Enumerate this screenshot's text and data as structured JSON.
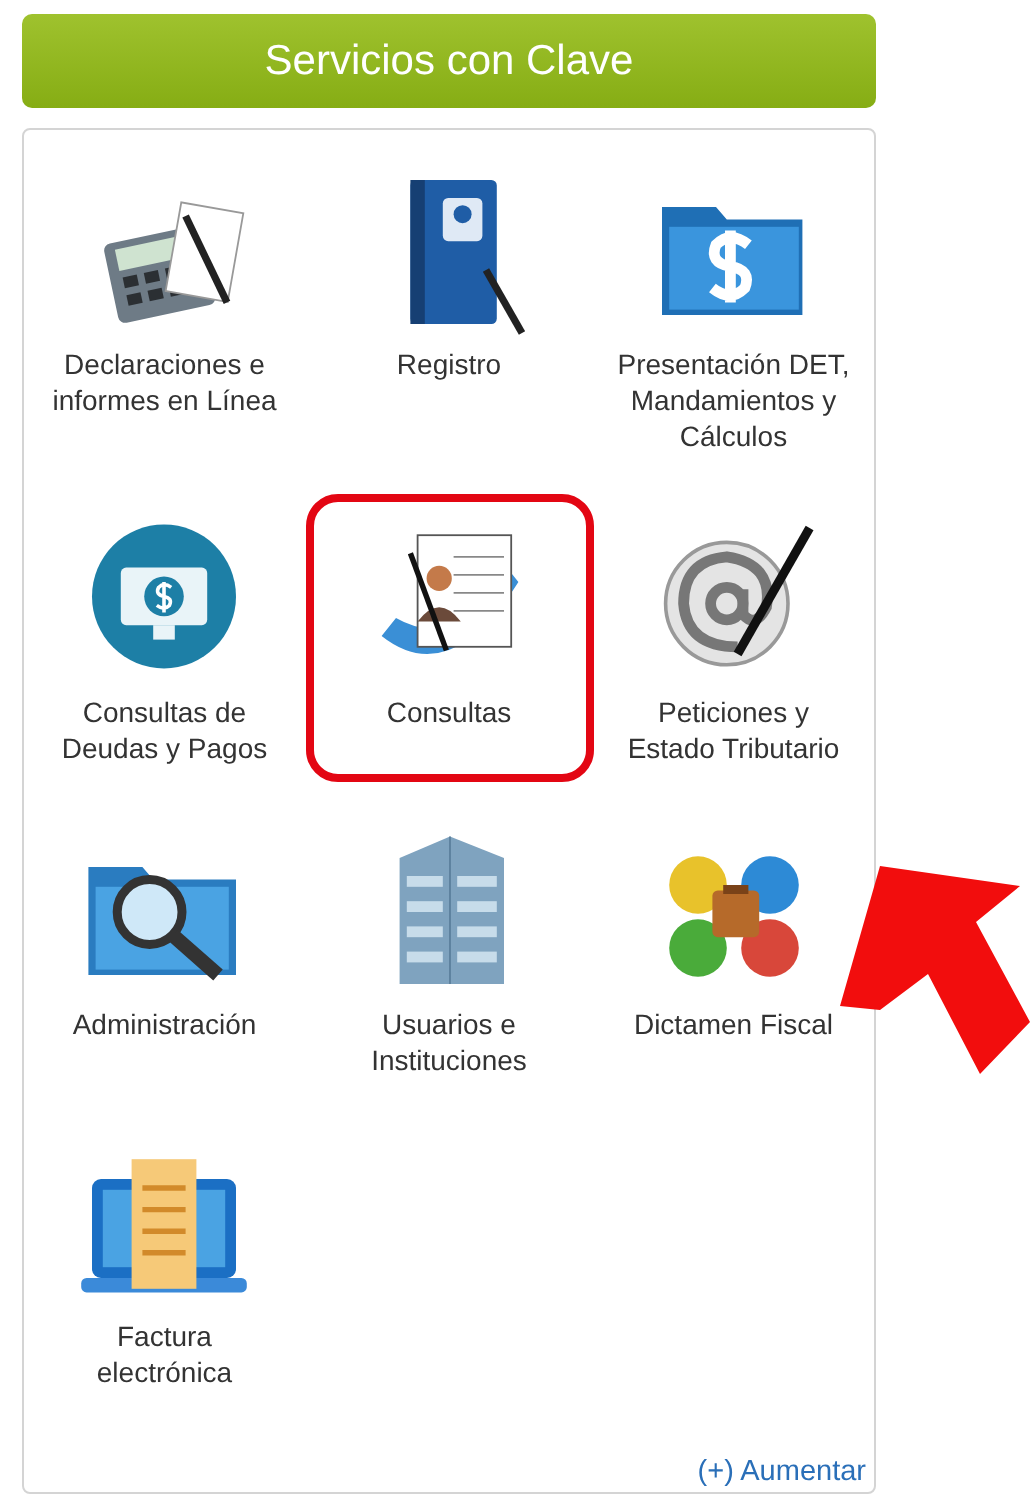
{
  "header": {
    "title": "Servicios con Clave"
  },
  "services": [
    {
      "kind": "calculator",
      "label": "Declaraciones e\ninformes en Línea",
      "selected": false
    },
    {
      "kind": "book",
      "label": "Registro",
      "selected": false
    },
    {
      "kind": "money-folder",
      "label": "Presentación DET,\nMandamientos y\nCálculos",
      "selected": false
    },
    {
      "kind": "money-monitor",
      "label": "Consultas de\nDeudas y Pagos",
      "selected": false
    },
    {
      "kind": "document",
      "label": "Consultas",
      "selected": true
    },
    {
      "kind": "at-pen",
      "label": "Peticiones y\nEstado Tributario",
      "selected": false
    },
    {
      "kind": "search-folder",
      "label": "Administración",
      "selected": false
    },
    {
      "kind": "building",
      "label": "Usuarios e\nInstituciones",
      "selected": false
    },
    {
      "kind": "puzzle",
      "label": "Dictamen Fiscal",
      "selected": false
    },
    {
      "kind": "invoice",
      "label": "Factura\nelectrónica",
      "selected": false
    }
  ],
  "more_link": "(+) Aumentar",
  "annotation": {
    "arrow": true
  }
}
